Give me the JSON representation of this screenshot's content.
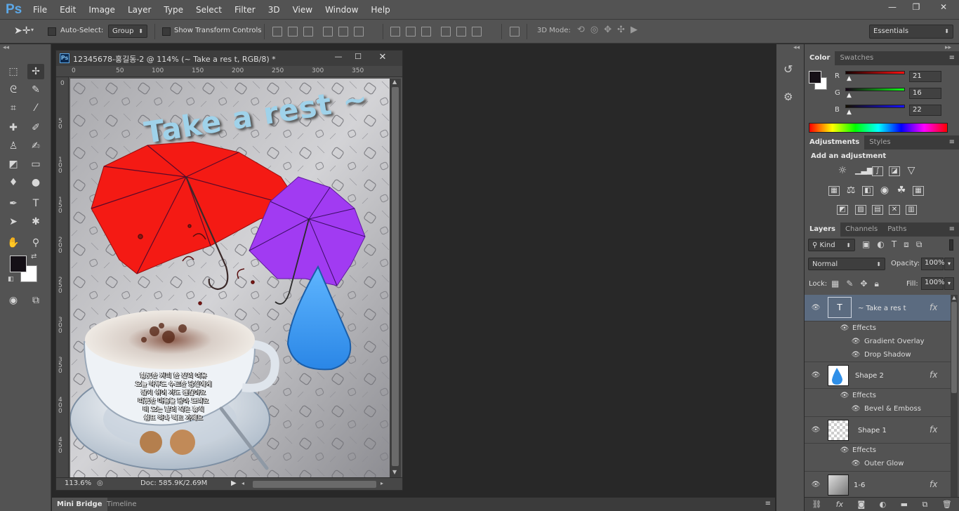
{
  "app": {
    "logo": "Ps"
  },
  "menu": [
    "File",
    "Edit",
    "Image",
    "Layer",
    "Type",
    "Select",
    "Filter",
    "3D",
    "View",
    "Window",
    "Help"
  ],
  "window_controls": [
    "—",
    "❐",
    "✕"
  ],
  "options": {
    "auto_select_label": "Auto-Select:",
    "auto_select_value": "Group",
    "show_transform_label": "Show Transform Controls",
    "mode_3d_label": "3D Mode:",
    "workspace": "Essentials"
  },
  "document": {
    "title": "12345678-홍길동-2 @ 114% (~ Take a res t, RGB/8) *",
    "zoom": "113.6%",
    "doc_size": "Doc: 585.9K/2.69M",
    "ruler_top": [
      "0",
      "50",
      "100",
      "150",
      "200",
      "250",
      "300",
      "350"
    ],
    "ruler_left": [
      "0",
      "50",
      "100",
      "150",
      "200",
      "250",
      "300",
      "350",
      "400",
      "450"
    ],
    "canvas_headline": "Take a rest ~",
    "poem_lines": [
      "향긋한 커피 한 잔의 여유",
      "오늘 하루도 수고한 당신에게",
      "잠시 쉬어 가도 괜찮아요",
      "따뜻한 마음을 담아 드려요",
      "비 오는 날의 작은 휴식",
      "쉼표 하나 찍고 가세요"
    ]
  },
  "color_panel": {
    "tabs": [
      "Color",
      "Swatches"
    ],
    "r_label": "R",
    "r_value": "21",
    "g_label": "G",
    "g_value": "16",
    "b_label": "B",
    "b_value": "22"
  },
  "adjustments_panel": {
    "tabs": [
      "Adjustments",
      "Styles"
    ],
    "heading": "Add an adjustment"
  },
  "layers_panel": {
    "tabs": [
      "Layers",
      "Channels",
      "Paths"
    ],
    "filter_kind": "Kind",
    "blend_mode": "Normal",
    "opacity_label": "Opacity:",
    "opacity_value": "100%",
    "lock_label": "Lock:",
    "fill_label": "Fill:",
    "fill_value": "100%",
    "layers": [
      {
        "name": "~ Take a res t",
        "effects_label": "Effects",
        "effects": [
          "Gradient Overlay",
          "Drop Shadow"
        ]
      },
      {
        "name": "Shape 2",
        "effects_label": "Effects",
        "effects": [
          "Bevel & Emboss"
        ]
      },
      {
        "name": "Shape 1",
        "effects_label": "Effects",
        "effects": [
          "Outer Glow"
        ]
      },
      {
        "name": "1-6"
      }
    ],
    "fx_label": "fx"
  },
  "bottom_tabs": [
    "Mini Bridge",
    "Timeline"
  ]
}
